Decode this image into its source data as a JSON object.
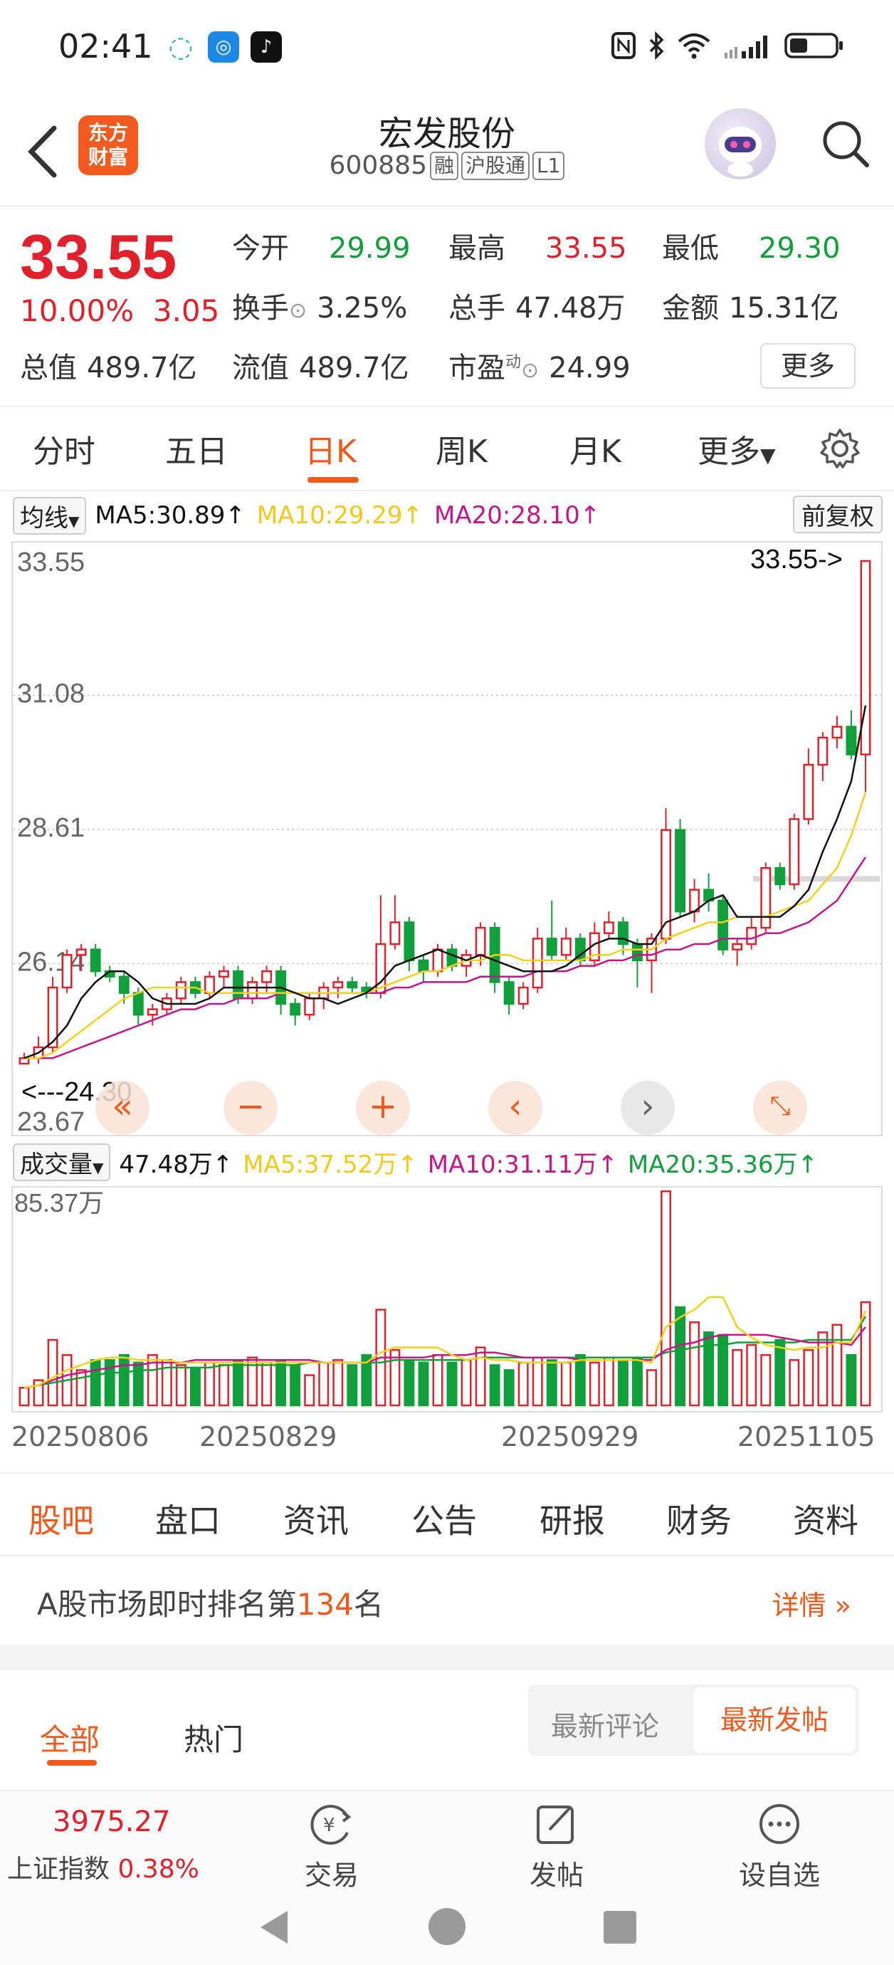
{
  "status": {
    "time": "02:41"
  },
  "header": {
    "logo_line1": "东方",
    "logo_line2": "财富",
    "title": "宏发股份",
    "code": "600885",
    "tags": [
      "融",
      "沪股通",
      "L1"
    ]
  },
  "quote": {
    "price": "33.55",
    "change_pct": "10.00%",
    "change": "3.05",
    "open_label": "今开",
    "open": "29.99",
    "high_label": "最高",
    "high": "33.55",
    "low_label": "最低",
    "low": "29.30",
    "turnover_label": "换手",
    "turnover": "3.25%",
    "volume_label": "总手",
    "volume": "47.48万",
    "amount_label": "金额",
    "amount": "15.31亿",
    "mktcap_label": "总值",
    "mktcap": "489.7亿",
    "float_label": "流值",
    "float": "489.7亿",
    "pe_label": "市盈",
    "pe_sup": "动",
    "pe": "24.99",
    "more": "更多"
  },
  "period_tabs": [
    "分时",
    "五日",
    "日K",
    "周K",
    "月K",
    "更多"
  ],
  "ma_legend": {
    "selector": "均线",
    "ma5": "MA5:30.89↑",
    "ma10": "MA10:29.29↑",
    "ma20": "MA20:28.10↑",
    "adjust": "前复权"
  },
  "vol_legend": {
    "selector": "成交量",
    "vol": "47.48万↑",
    "ma5": "MA5:37.52万↑",
    "ma10": "MA10:31.11万↑",
    "ma20": "MA20:35.36万↑"
  },
  "colors": {
    "up": "#e0202b",
    "down": "#109f3a",
    "ma5": "#111111",
    "ma10": "#f2d11a",
    "ma20": "#c3168a",
    "accent": "#f0581c"
  },
  "icons": [
    "back-arrow-icon",
    "search-icon",
    "gear-icon",
    "zoom-out-icon",
    "zoom-in-icon",
    "scroll-left-icon",
    "scroll-right-icon",
    "fullscreen-icon",
    "trade-icon",
    "post-icon",
    "watchlist-icon"
  ],
  "chart_data": [
    {
      "type": "candlestick",
      "title": "",
      "y_ticks": [
        "33.55",
        "31.08",
        "28.61",
        "26.14",
        "23.67"
      ],
      "ylim": [
        23.67,
        33.55
      ],
      "high_marker": "33.55->",
      "low_marker": "<---24.30",
      "x_ticks": [
        "20250806",
        "20250829",
        "20250929",
        "20251105"
      ],
      "candles": [
        {
          "o": 24.3,
          "c": 24.4,
          "h": 24.5,
          "l": 24.3
        },
        {
          "o": 24.4,
          "c": 24.6,
          "h": 24.8,
          "l": 24.3
        },
        {
          "o": 24.6,
          "c": 25.7,
          "h": 25.9,
          "l": 24.5
        },
        {
          "o": 25.7,
          "c": 26.3,
          "h": 26.4,
          "l": 25.6
        },
        {
          "o": 26.3,
          "c": 26.4,
          "h": 26.5,
          "l": 26.0
        },
        {
          "o": 26.4,
          "c": 26.0,
          "h": 26.5,
          "l": 25.9
        },
        {
          "o": 26.0,
          "c": 25.9,
          "h": 26.1,
          "l": 25.8
        },
        {
          "o": 25.9,
          "c": 25.6,
          "h": 26.0,
          "l": 25.4
        },
        {
          "o": 25.6,
          "c": 25.2,
          "h": 25.7,
          "l": 25.0
        },
        {
          "o": 25.2,
          "c": 25.3,
          "h": 25.4,
          "l": 25.0
        },
        {
          "o": 25.3,
          "c": 25.5,
          "h": 25.6,
          "l": 25.2
        },
        {
          "o": 25.5,
          "c": 25.8,
          "h": 25.9,
          "l": 25.4
        },
        {
          "o": 25.8,
          "c": 25.6,
          "h": 25.9,
          "l": 25.5
        },
        {
          "o": 25.6,
          "c": 25.9,
          "h": 26.0,
          "l": 25.5
        },
        {
          "o": 25.9,
          "c": 26.0,
          "h": 26.1,
          "l": 25.7
        },
        {
          "o": 26.0,
          "c": 25.5,
          "h": 26.1,
          "l": 25.4
        },
        {
          "o": 25.5,
          "c": 25.8,
          "h": 25.9,
          "l": 25.4
        },
        {
          "o": 25.8,
          "c": 26.0,
          "h": 26.1,
          "l": 25.6
        },
        {
          "o": 26.0,
          "c": 25.4,
          "h": 26.1,
          "l": 25.2
        },
        {
          "o": 25.4,
          "c": 25.2,
          "h": 25.5,
          "l": 25.0
        },
        {
          "o": 25.2,
          "c": 25.5,
          "h": 25.6,
          "l": 25.1
        },
        {
          "o": 25.5,
          "c": 25.7,
          "h": 25.8,
          "l": 25.3
        },
        {
          "o": 25.7,
          "c": 25.8,
          "h": 25.9,
          "l": 25.5
        },
        {
          "o": 25.8,
          "c": 25.7,
          "h": 25.9,
          "l": 25.6
        },
        {
          "o": 25.7,
          "c": 25.6,
          "h": 25.8,
          "l": 25.5
        },
        {
          "o": 25.6,
          "c": 26.5,
          "h": 27.4,
          "l": 25.5
        },
        {
          "o": 26.5,
          "c": 26.9,
          "h": 27.4,
          "l": 26.4
        },
        {
          "o": 26.9,
          "c": 26.2,
          "h": 27.0,
          "l": 26.0
        },
        {
          "o": 26.2,
          "c": 26.0,
          "h": 26.3,
          "l": 25.8
        },
        {
          "o": 26.0,
          "c": 26.4,
          "h": 26.5,
          "l": 25.9
        },
        {
          "o": 26.4,
          "c": 26.1,
          "h": 26.5,
          "l": 26.0
        },
        {
          "o": 26.1,
          "c": 26.3,
          "h": 26.4,
          "l": 25.9
        },
        {
          "o": 26.3,
          "c": 26.8,
          "h": 26.9,
          "l": 26.1
        },
        {
          "o": 26.8,
          "c": 25.8,
          "h": 26.9,
          "l": 25.6
        },
        {
          "o": 25.8,
          "c": 25.4,
          "h": 25.9,
          "l": 25.2
        },
        {
          "o": 25.4,
          "c": 25.7,
          "h": 25.8,
          "l": 25.3
        },
        {
          "o": 25.7,
          "c": 26.6,
          "h": 26.8,
          "l": 25.6
        },
        {
          "o": 26.6,
          "c": 26.3,
          "h": 27.3,
          "l": 26.2
        },
        {
          "o": 26.3,
          "c": 26.6,
          "h": 26.8,
          "l": 26.2
        },
        {
          "o": 26.6,
          "c": 26.2,
          "h": 26.7,
          "l": 26.1
        },
        {
          "o": 26.2,
          "c": 26.7,
          "h": 26.9,
          "l": 26.1
        },
        {
          "o": 26.7,
          "c": 26.9,
          "h": 27.1,
          "l": 26.6
        },
        {
          "o": 26.9,
          "c": 26.5,
          "h": 27.0,
          "l": 26.3
        },
        {
          "o": 26.5,
          "c": 26.2,
          "h": 26.6,
          "l": 25.7
        },
        {
          "o": 26.2,
          "c": 26.6,
          "h": 26.7,
          "l": 25.6
        },
        {
          "o": 26.6,
          "c": 28.6,
          "h": 29.0,
          "l": 26.5
        },
        {
          "o": 28.6,
          "c": 27.1,
          "h": 28.8,
          "l": 27.0
        },
        {
          "o": 27.1,
          "c": 27.5,
          "h": 27.7,
          "l": 26.9
        },
        {
          "o": 27.5,
          "c": 27.3,
          "h": 27.8,
          "l": 27.1
        },
        {
          "o": 27.3,
          "c": 26.4,
          "h": 27.4,
          "l": 26.3
        },
        {
          "o": 26.4,
          "c": 26.5,
          "h": 26.6,
          "l": 26.1
        },
        {
          "o": 26.5,
          "c": 26.8,
          "h": 27.0,
          "l": 26.4
        },
        {
          "o": 26.8,
          "c": 27.9,
          "h": 28.0,
          "l": 26.7
        },
        {
          "o": 27.9,
          "c": 27.6,
          "h": 28.0,
          "l": 27.5
        },
        {
          "o": 27.6,
          "c": 28.8,
          "h": 28.9,
          "l": 27.5
        },
        {
          "o": 28.8,
          "c": 29.8,
          "h": 30.1,
          "l": 28.7
        },
        {
          "o": 29.8,
          "c": 30.3,
          "h": 30.4,
          "l": 29.5
        },
        {
          "o": 30.3,
          "c": 30.5,
          "h": 30.7,
          "l": 30.1
        },
        {
          "o": 30.5,
          "c": 29.99,
          "h": 30.8,
          "l": 29.9
        },
        {
          "o": 29.99,
          "c": 33.55,
          "h": 33.55,
          "l": 29.3
        }
      ],
      "ma5": [
        24.4,
        24.5,
        24.7,
        25.0,
        25.5,
        25.8,
        26.0,
        26.0,
        25.8,
        25.5,
        25.4,
        25.4,
        25.4,
        25.5,
        25.7,
        25.7,
        25.7,
        25.7,
        25.7,
        25.6,
        25.5,
        25.5,
        25.4,
        25.5,
        25.6,
        25.8,
        26.1,
        26.2,
        26.3,
        26.4,
        26.3,
        26.2,
        26.3,
        26.2,
        26.1,
        26.0,
        26.0,
        26.0,
        26.1,
        26.3,
        26.5,
        26.6,
        26.6,
        26.5,
        26.5,
        26.9,
        27.0,
        27.1,
        27.3,
        27.4,
        27.0,
        27.0,
        27.0,
        27.0,
        27.2,
        27.5,
        28.2,
        28.8,
        29.5,
        30.89
      ],
      "ma10": [
        24.4,
        24.4,
        24.5,
        24.7,
        24.9,
        25.1,
        25.3,
        25.5,
        25.6,
        25.7,
        25.7,
        25.7,
        25.7,
        25.6,
        25.6,
        25.6,
        25.6,
        25.6,
        25.6,
        25.6,
        25.6,
        25.6,
        25.6,
        25.6,
        25.6,
        25.7,
        25.8,
        25.9,
        26.0,
        26.0,
        26.1,
        26.2,
        26.2,
        26.3,
        26.3,
        26.2,
        26.2,
        26.2,
        26.2,
        26.2,
        26.3,
        26.3,
        26.4,
        26.4,
        26.4,
        26.6,
        26.7,
        26.8,
        26.9,
        26.9,
        27.0,
        27.0,
        27.0,
        27.1,
        27.2,
        27.3,
        27.6,
        27.9,
        28.5,
        29.29
      ],
      "ma20": [
        24.4,
        24.4,
        24.4,
        24.5,
        24.6,
        24.7,
        24.8,
        24.9,
        25.0,
        25.1,
        25.2,
        25.3,
        25.3,
        25.4,
        25.4,
        25.5,
        25.5,
        25.5,
        25.6,
        25.6,
        25.6,
        25.6,
        25.6,
        25.6,
        25.6,
        25.6,
        25.7,
        25.7,
        25.8,
        25.8,
        25.8,
        25.8,
        25.9,
        25.9,
        25.9,
        25.9,
        26.0,
        26.0,
        26.0,
        26.1,
        26.1,
        26.2,
        26.2,
        26.3,
        26.3,
        26.4,
        26.4,
        26.5,
        26.5,
        26.6,
        26.6,
        26.6,
        26.7,
        26.7,
        26.8,
        26.9,
        27.1,
        27.3,
        27.7,
        28.1
      ]
    },
    {
      "type": "bar",
      "title": "",
      "y_ticks": [
        "85.37万"
      ],
      "ylim": [
        0,
        85.37
      ],
      "values": [
        7,
        10,
        26,
        20,
        14,
        18,
        18,
        20,
        17,
        20,
        18,
        16,
        15,
        17,
        16,
        18,
        19,
        17,
        18,
        16,
        12,
        17,
        18,
        16,
        20,
        38,
        22,
        18,
        17,
        20,
        17,
        18,
        23,
        16,
        14,
        17,
        19,
        18,
        17,
        20,
        17,
        19,
        18,
        19,
        14,
        85,
        39,
        33,
        29,
        28,
        22,
        24,
        20,
        26,
        18,
        22,
        29,
        32,
        20,
        41
      ],
      "up": [
        1,
        1,
        1,
        1,
        1,
        0,
        0,
        0,
        0,
        1,
        1,
        1,
        0,
        1,
        1,
        0,
        1,
        1,
        0,
        0,
        1,
        1,
        1,
        0,
        0,
        1,
        1,
        0,
        0,
        1,
        0,
        1,
        1,
        0,
        0,
        1,
        1,
        0,
        1,
        0,
        1,
        1,
        0,
        0,
        1,
        1,
        0,
        1,
        0,
        0,
        1,
        1,
        1,
        0,
        1,
        1,
        1,
        1,
        0,
        1
      ],
      "ma5": [
        7,
        8,
        11,
        14,
        16,
        18,
        19,
        19,
        18,
        18,
        18,
        17,
        17,
        17,
        17,
        17,
        17,
        17,
        17,
        17,
        17,
        17,
        17,
        17,
        17,
        21,
        23,
        23,
        23,
        23,
        20,
        18,
        19,
        18,
        18,
        17,
        17,
        17,
        17,
        18,
        18,
        18,
        18,
        18,
        17,
        31,
        35,
        38,
        43,
        43,
        31,
        27,
        24,
        23,
        22,
        23,
        23,
        25,
        25,
        37.52
      ],
      "ma10": [
        7,
        8,
        10,
        12,
        13,
        14,
        15,
        16,
        16,
        17,
        17,
        17,
        18,
        18,
        18,
        18,
        18,
        18,
        18,
        18,
        18,
        17,
        17,
        17,
        17,
        19,
        19,
        19,
        19,
        20,
        20,
        20,
        21,
        21,
        20,
        19,
        19,
        19,
        19,
        18,
        18,
        18,
        18,
        18,
        18,
        22,
        24,
        25,
        27,
        28,
        28,
        28,
        28,
        27,
        26,
        25,
        25,
        25,
        24,
        31.11
      ],
      "ma20": [
        7,
        8,
        9,
        10,
        11,
        12,
        13,
        13,
        14,
        14,
        15,
        15,
        15,
        15,
        16,
        16,
        16,
        16,
        16,
        16,
        17,
        17,
        17,
        17,
        17,
        17,
        18,
        18,
        18,
        18,
        18,
        18,
        19,
        19,
        19,
        19,
        19,
        19,
        19,
        19,
        19,
        19,
        19,
        19,
        19,
        21,
        22,
        23,
        24,
        24,
        25,
        25,
        25,
        25,
        25,
        26,
        26,
        26,
        26,
        35.36
      ]
    }
  ],
  "chart_tools": {
    "zoom_out": "−",
    "zoom_in": "+",
    "left": "‹",
    "right": "›"
  },
  "section_tabs": [
    "股吧",
    "盘口",
    "资讯",
    "公告",
    "研报",
    "财务",
    "资料"
  ],
  "rank": {
    "prefix": "A股市场即时排名第",
    "num": "134",
    "suffix": "名",
    "detail": "详情"
  },
  "feed_tabs": {
    "all": "全部",
    "hot": "热门",
    "sort_comment": "最新评论",
    "sort_post": "最新发帖"
  },
  "bottom_nav": {
    "index_value": "3975.27",
    "index_name": "上证指数",
    "index_pct": "0.38%",
    "trade": "交易",
    "post": "发帖",
    "watch": "设自选"
  }
}
